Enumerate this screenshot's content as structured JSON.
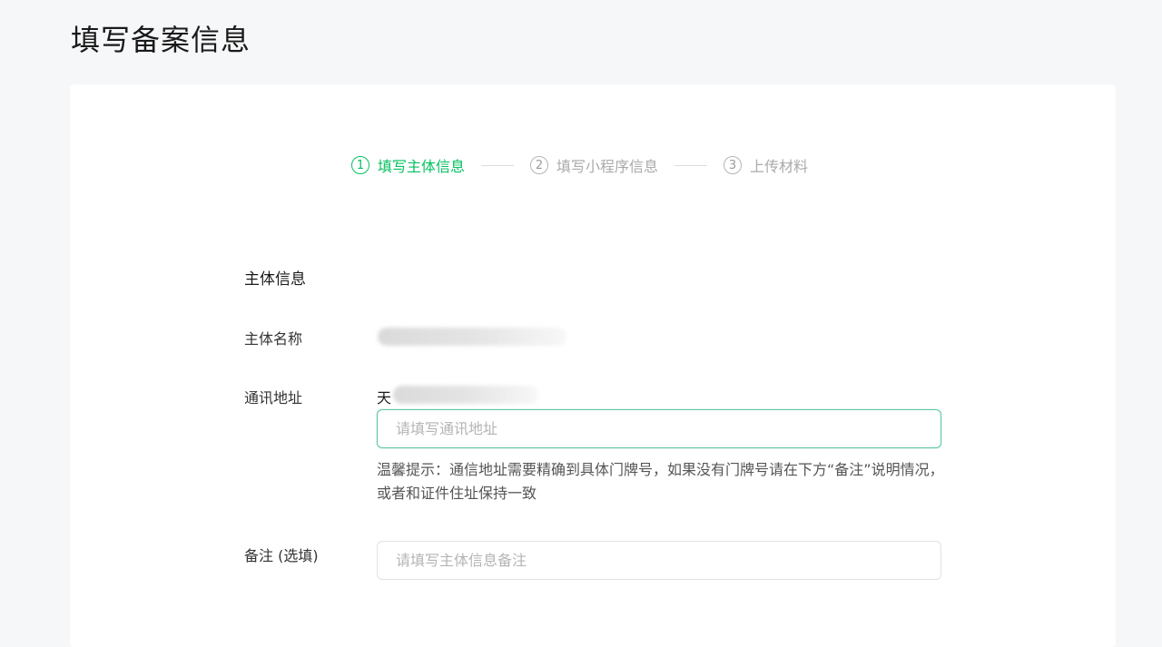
{
  "page": {
    "title": "填写备案信息"
  },
  "steps": [
    {
      "number": "1",
      "label": "填写主体信息",
      "active": true
    },
    {
      "number": "2",
      "label": "填写小程序信息",
      "active": false
    },
    {
      "number": "3",
      "label": "上传材料",
      "active": false
    }
  ],
  "form": {
    "section_title": "主体信息",
    "subject_name": {
      "label": "主体名称",
      "value": ""
    },
    "address": {
      "label": "通讯地址",
      "prefix": "天",
      "placeholder": "请填写通讯地址",
      "hint": "温馨提示：通信地址需要精确到具体门牌号，如果没有门牌号请在下方“备注”说明情况，或者和证件住址保持一致"
    },
    "remark": {
      "label": "备注 (选填)",
      "placeholder": "请填写主体信息备注"
    }
  },
  "colors": {
    "accent": "#07c160",
    "focus_border": "#5fc8a4",
    "inactive": "#aaaaaa"
  }
}
